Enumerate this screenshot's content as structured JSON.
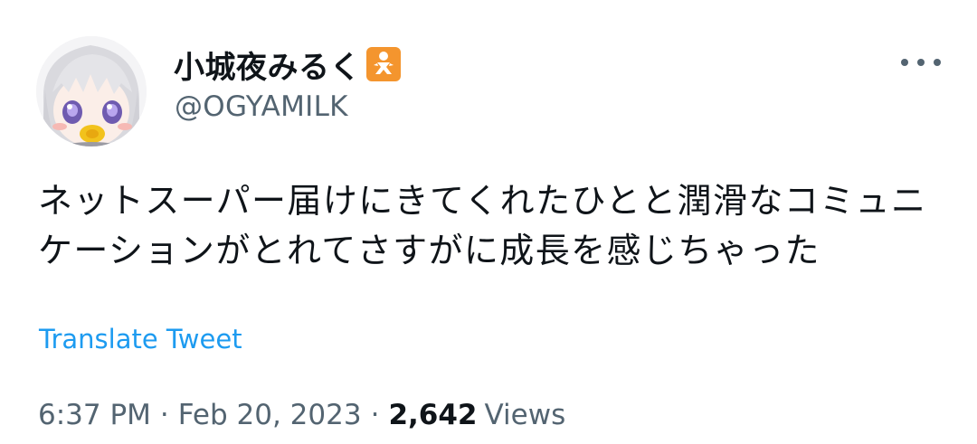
{
  "author": {
    "display_name": "小城夜みるく",
    "handle": "@OGYAMILK",
    "badge_icon": "baby-emoji-icon",
    "badge_color": "#f4952e"
  },
  "menu": {
    "icon": "more-options-icon"
  },
  "tweet": {
    "text": "ネットスーパー届けにきてくれたひとと潤滑なコミュニケーションがとれてさすがに成長を感じちゃった",
    "translate_label": "Translate Tweet"
  },
  "meta": {
    "time": "6:37 PM",
    "separator": "·",
    "date": "Feb 20, 2023",
    "views_count": "2,642",
    "views_label": "Views"
  },
  "colors": {
    "text": "#0f1419",
    "secondary": "#536471",
    "link": "#1d9bf0"
  }
}
